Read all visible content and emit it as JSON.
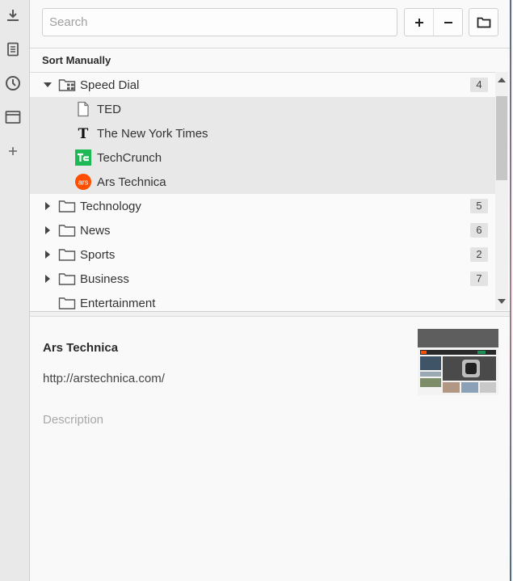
{
  "rail": {
    "items": [
      {
        "name": "downloads-icon"
      },
      {
        "name": "notes-icon"
      },
      {
        "name": "history-icon"
      },
      {
        "name": "window-icon"
      },
      {
        "name": "add-panel-icon"
      }
    ]
  },
  "search": {
    "placeholder": "Search"
  },
  "toolbar": {
    "add_label": "+",
    "remove_label": "−"
  },
  "sort_label": "Sort Manually",
  "tree": {
    "speed_dial": {
      "label": "Speed Dial",
      "count": "4"
    },
    "children": [
      {
        "label": "TED",
        "icon": "page-icon"
      },
      {
        "label": "The New York Times",
        "icon": "nyt-icon"
      },
      {
        "label": "TechCrunch",
        "icon": "techcrunch-icon"
      },
      {
        "label": "Ars Technica",
        "icon": "ars-icon",
        "icon_text": "ars"
      }
    ],
    "folders": [
      {
        "label": "Technology",
        "count": "5"
      },
      {
        "label": "News",
        "count": "6"
      },
      {
        "label": "Sports",
        "count": "2"
      },
      {
        "label": "Business",
        "count": "7"
      },
      {
        "label": "Entertainment",
        "count": ""
      }
    ]
  },
  "details": {
    "title": "Ars Technica",
    "url": "http://arstechnica.com/",
    "description_placeholder": "Description"
  },
  "colors": {
    "techcrunch": "#1db954",
    "ars": "#ff4e00",
    "selection": "#e8e8e8"
  }
}
